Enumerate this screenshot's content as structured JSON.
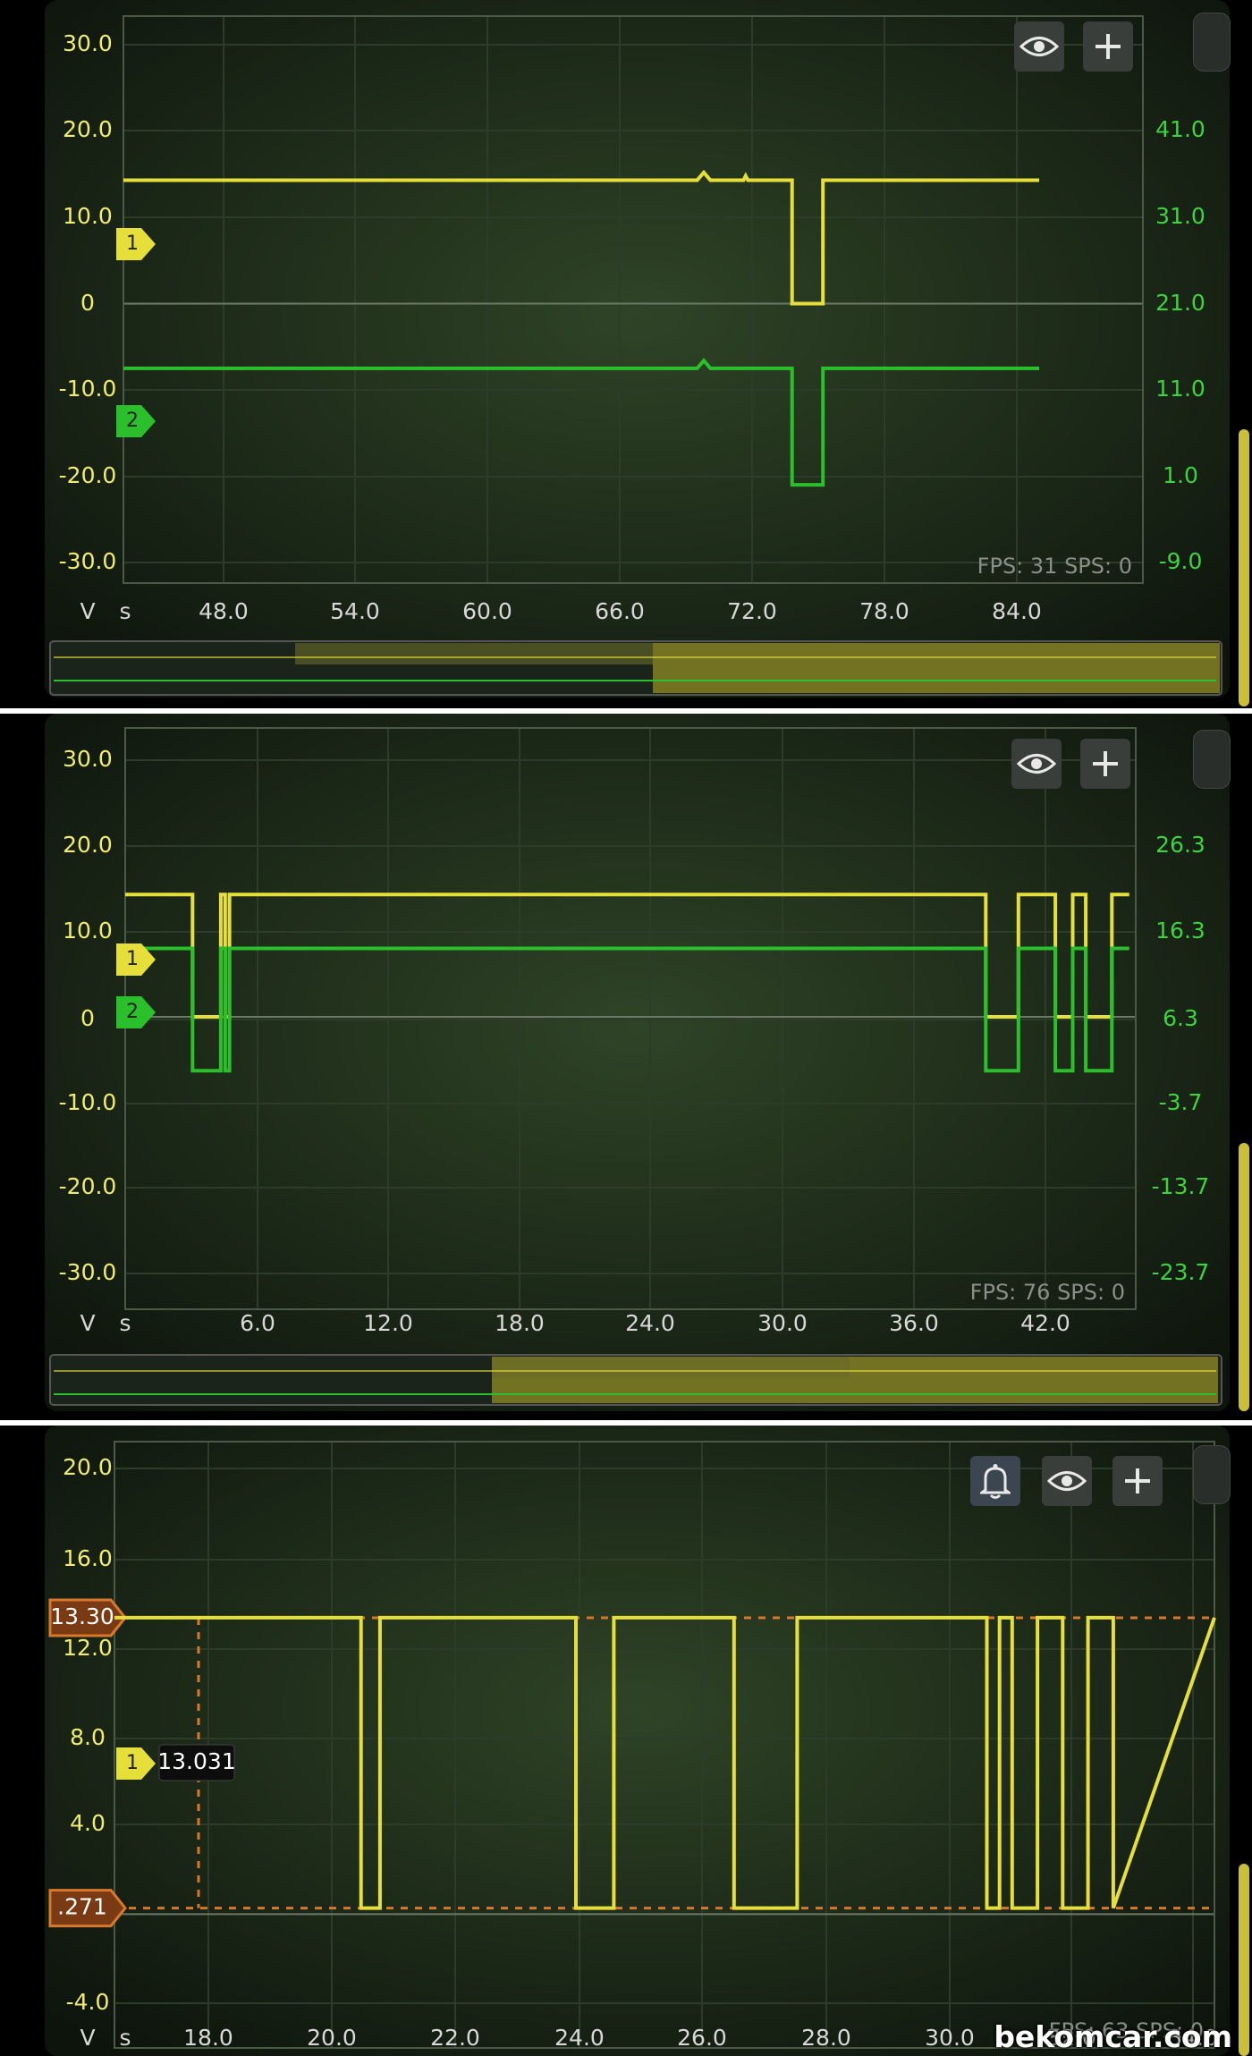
{
  "watermark": "bekomcar.com",
  "colors": {
    "ch1": "#e6df3a",
    "ch2": "#2bbf2b",
    "cursor": "#d8782c",
    "axis_left": "#f2ec6e",
    "axis_right": "#3fd23f",
    "grid": "#2c3b2a"
  },
  "icons": [
    "eye-icon",
    "plus-icon",
    "bell-icon"
  ],
  "chart_data": [
    {
      "type": "line",
      "left_unit": "V",
      "x_unit": "s",
      "x_ticks": [
        "48.0",
        "54.0",
        "60.0",
        "66.0",
        "72.0",
        "78.0",
        "84.0"
      ],
      "xlim": [
        43.5,
        89.7
      ],
      "left_ticks": [
        "30.0",
        "20.0",
        "10.0",
        "0",
        "-10.0",
        "-20.0",
        "-30.0"
      ],
      "ylim_left": [
        -30,
        30
      ],
      "right_ticks": [
        "41.0",
        "31.0",
        "21.0",
        "11.0",
        "1.0",
        "-9.0"
      ],
      "ylim_right": [
        -9,
        41
      ],
      "status": "FPS: 31  SPS: 0",
      "markers": [
        "1",
        "2"
      ],
      "series": [
        {
          "axis": "left",
          "x": [
            43.5,
            69.5,
            69.8,
            70.1,
            71.6,
            71.7,
            71.8,
            73.8,
            73.8,
            75.2,
            75.2,
            85.0
          ],
          "y": [
            14.3,
            14.3,
            15.2,
            14.3,
            14.3,
            14.8,
            14.3,
            14.3,
            0,
            0,
            14.3,
            14.3
          ]
        },
        {
          "axis": "left",
          "x": [
            43.5,
            69.5,
            69.8,
            70.1,
            73.8,
            73.8,
            75.2,
            75.2,
            85.0
          ],
          "y": [
            -7.5,
            -7.5,
            -6.6,
            -7.5,
            -7.5,
            -21.0,
            -21.0,
            -7.5,
            -7.5
          ]
        }
      ]
    },
    {
      "type": "line",
      "left_unit": "V",
      "x_unit": "s",
      "x_ticks": [
        "6.0",
        "12.0",
        "18.0",
        "24.0",
        "30.0",
        "36.0",
        "42.0"
      ],
      "xlim": [
        0,
        46.5
      ],
      "left_ticks": [
        "30.0",
        "20.0",
        "10.0",
        "0",
        "-10.0",
        "-20.0",
        "-30.0"
      ],
      "ylim_left": [
        -30,
        30
      ],
      "right_ticks": [
        "26.3",
        "16.3",
        "6.3",
        "-3.7",
        "-13.7",
        "-23.7"
      ],
      "ylim_right": [
        -23.7,
        26.3
      ],
      "status": "FPS: 76  SPS: 0",
      "markers": [
        "1",
        "2"
      ],
      "series": [
        {
          "axis": "left",
          "x": [
            0,
            3.1,
            3.1,
            4.4,
            4.4,
            4.6,
            4.6,
            4.8,
            4.8,
            6.1,
            6.1,
            39.6,
            39.6,
            41.1,
            41.1,
            42.8,
            42.8,
            43.6,
            43.6,
            44.2,
            44.2,
            45.4,
            45.4,
            46.2
          ],
          "y": [
            14.3,
            14.3,
            0,
            0,
            14.3,
            14.3,
            0,
            0,
            14.3,
            14.3,
            14.3,
            14.3,
            0,
            0,
            14.3,
            14.3,
            0,
            0,
            14.3,
            14.3,
            0,
            0,
            14.3,
            14.3
          ]
        },
        {
          "axis": "left",
          "x": [
            0,
            3.1,
            3.1,
            4.4,
            4.4,
            4.6,
            4.6,
            4.8,
            4.8,
            6.1,
            6.1,
            39.6,
            39.6,
            41.1,
            41.1,
            42.8,
            42.8,
            43.6,
            43.6,
            44.2,
            44.2,
            45.4,
            45.4,
            46.2
          ],
          "y": [
            8.0,
            8.0,
            -6.3,
            -6.3,
            8.0,
            8.0,
            -6.3,
            -6.3,
            8.0,
            8.0,
            8.0,
            8.0,
            -6.3,
            -6.3,
            8.0,
            8.0,
            -6.3,
            -6.3,
            8.0,
            8.0,
            -6.3,
            -6.3,
            8.0,
            8.0
          ]
        }
      ]
    },
    {
      "type": "line",
      "left_unit": "V",
      "x_unit": "s",
      "x_ticks": [
        "18.0",
        "20.0",
        "22.0",
        "24.0",
        "26.0",
        "28.0",
        "30.0",
        "32.0",
        "34.0"
      ],
      "xlim": [
        16.9,
        34.3
      ],
      "left_ticks": [
        "20.0",
        "16.0",
        "12.0",
        "8.0",
        "4.0",
        "-4.0"
      ],
      "ylim_left": [
        -4,
        20
      ],
      "status": "FPS: 63  SPS: 0",
      "markers": [
        "1"
      ],
      "cursor_high": "13.30",
      "cursor_low": ".271",
      "cursor_readout": "13.031",
      "series": [
        {
          "axis": "left",
          "x": [
            16.9,
            20.8,
            20.8,
            21.1,
            21.1,
            24.2,
            24.2,
            24.8,
            24.8,
            26.7,
            26.7,
            27.7,
            27.7,
            30.7,
            30.7,
            30.9,
            30.9,
            31.1,
            31.1,
            31.5,
            31.5,
            31.9,
            31.9,
            32.3,
            32.3,
            32.7,
            32.7,
            34.3
          ],
          "y": [
            13.3,
            13.3,
            0.27,
            0.27,
            13.3,
            13.3,
            0.27,
            0.27,
            13.3,
            13.3,
            0.27,
            0.27,
            13.3,
            13.3,
            0.27,
            0.27,
            13.3,
            13.3,
            0.27,
            0.27,
            13.3,
            13.3,
            0.27,
            0.27,
            13.3,
            13.3,
            0.27,
            13.3
          ]
        }
      ]
    }
  ]
}
